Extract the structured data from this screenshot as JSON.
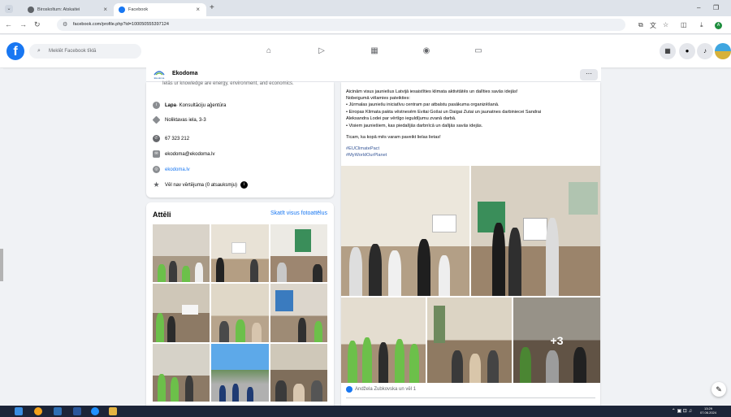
{
  "browser": {
    "tabs": [
      {
        "title": "Biroskoltum: Atskaitei",
        "active": false
      },
      {
        "title": "Facebook",
        "active": true
      }
    ],
    "url": "facebook.com/profile.php?id=100050555397124"
  },
  "facebook": {
    "search_placeholder": "Meklēt Facebook tīklā",
    "logo": "f"
  },
  "page_header": {
    "logo_text": "Ekodoma",
    "name": "Ekodoma",
    "more": "···"
  },
  "intro": {
    "cutoff_text": "Ielās ur knowledge are energy, environment, and economics.",
    "category_label": "Lapa",
    "category": " · Konsultāciju aģentūra",
    "address": "Noliktavas iela, 3-3",
    "phone": "67 323 212",
    "email": "ekodoma@ekodoma.lv",
    "website": "ekodoma.lv",
    "rating": "Vēl nav vērtējuma (0 atsauksmju)"
  },
  "photos": {
    "title": "Attēli",
    "see_all": "Skatīt visus fotoattēlus"
  },
  "post": {
    "lines": [
      "Aicinām visus jauniešus Latvijā iesaistīties klimata aktivitātēs un dalīties savās idejās!",
      "Nobeigumā vēlamies pateikties:",
      "• Jūrmalas jauniešu iniciatīvu centram par atbalstu pasākuma organizēšanā.",
      "• Eiropas Klimata pakta vēstnesēm Evitai Gošai un Daigai Zutai un jaunatnes darbiniecei Sandrai",
      "Aleksandra Lodei par vērtīgo ieguldījumu zvanā darbā.",
      "• Visiem jauniešiem, kas piedalījās darbnīcā un dalījās savās idejās.",
      "Ticam, ka kopā mēs varam paveikt lielas lietas!"
    ],
    "hashtags": [
      "#EUClimatePact",
      "#MyWorldOurPlanet"
    ],
    "more_photos": "+3",
    "reactions": "Andžela Zubkovska un vēl 1"
  },
  "taskbar": {
    "time": "13:29",
    "date": "07.06.2024"
  },
  "colors": {
    "fb_blue": "#1877f2",
    "background": "#f0f2f5"
  }
}
